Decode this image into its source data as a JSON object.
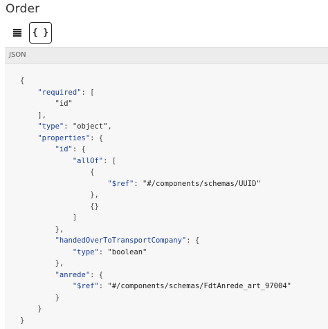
{
  "header": {
    "title": "Order"
  },
  "toolbar": {
    "list_view_icon": "list-icon",
    "json_view_label": "{ }"
  },
  "panel": {
    "label": "JSON"
  },
  "code": {
    "lines": [
      {
        "indent": 0,
        "parts": [
          {
            "t": "punc",
            "v": "{"
          }
        ]
      },
      {
        "indent": 1,
        "parts": [
          {
            "t": "key",
            "v": "\"required\""
          },
          {
            "t": "punc",
            "v": ": ["
          }
        ]
      },
      {
        "indent": 2,
        "parts": [
          {
            "t": "str",
            "v": "\"id\""
          }
        ]
      },
      {
        "indent": 1,
        "parts": [
          {
            "t": "punc",
            "v": "],"
          }
        ]
      },
      {
        "indent": 1,
        "parts": [
          {
            "t": "key",
            "v": "\"type\""
          },
          {
            "t": "punc",
            "v": ": "
          },
          {
            "t": "str",
            "v": "\"object\""
          },
          {
            "t": "punc",
            "v": ","
          }
        ]
      },
      {
        "indent": 1,
        "parts": [
          {
            "t": "key",
            "v": "\"properties\""
          },
          {
            "t": "punc",
            "v": ": {"
          }
        ]
      },
      {
        "indent": 2,
        "parts": [
          {
            "t": "key",
            "v": "\"id\""
          },
          {
            "t": "punc",
            "v": ": {"
          }
        ]
      },
      {
        "indent": 3,
        "parts": [
          {
            "t": "key",
            "v": "\"allOf\""
          },
          {
            "t": "punc",
            "v": ": ["
          }
        ]
      },
      {
        "indent": 4,
        "parts": [
          {
            "t": "punc",
            "v": "{"
          }
        ]
      },
      {
        "indent": 5,
        "parts": [
          {
            "t": "key",
            "v": "\"$ref\""
          },
          {
            "t": "punc",
            "v": ": "
          },
          {
            "t": "str",
            "v": "\"#/components/schemas/UUID\""
          }
        ]
      },
      {
        "indent": 4,
        "parts": [
          {
            "t": "punc",
            "v": "},"
          }
        ]
      },
      {
        "indent": 4,
        "parts": [
          {
            "t": "punc",
            "v": "{}"
          }
        ]
      },
      {
        "indent": 3,
        "parts": [
          {
            "t": "punc",
            "v": "]"
          }
        ]
      },
      {
        "indent": 2,
        "parts": [
          {
            "t": "punc",
            "v": "},"
          }
        ]
      },
      {
        "indent": 2,
        "parts": [
          {
            "t": "key",
            "v": "\"handedOverToTransportCompany\""
          },
          {
            "t": "punc",
            "v": ": {"
          }
        ]
      },
      {
        "indent": 3,
        "parts": [
          {
            "t": "key",
            "v": "\"type\""
          },
          {
            "t": "punc",
            "v": ": "
          },
          {
            "t": "str",
            "v": "\"boolean\""
          }
        ]
      },
      {
        "indent": 2,
        "parts": [
          {
            "t": "punc",
            "v": "},"
          }
        ]
      },
      {
        "indent": 2,
        "parts": [
          {
            "t": "key",
            "v": "\"anrede\""
          },
          {
            "t": "punc",
            "v": ": {"
          }
        ]
      },
      {
        "indent": 3,
        "parts": [
          {
            "t": "key",
            "v": "\"$ref\""
          },
          {
            "t": "punc",
            "v": ": "
          },
          {
            "t": "str",
            "v": "\"#/components/schemas/FdtAnrede_art_97004\""
          }
        ]
      },
      {
        "indent": 2,
        "parts": [
          {
            "t": "punc",
            "v": "}"
          }
        ]
      },
      {
        "indent": 1,
        "parts": [
          {
            "t": "punc",
            "v": "}"
          }
        ]
      },
      {
        "indent": 0,
        "parts": [
          {
            "t": "punc",
            "v": "}"
          }
        ]
      }
    ]
  }
}
